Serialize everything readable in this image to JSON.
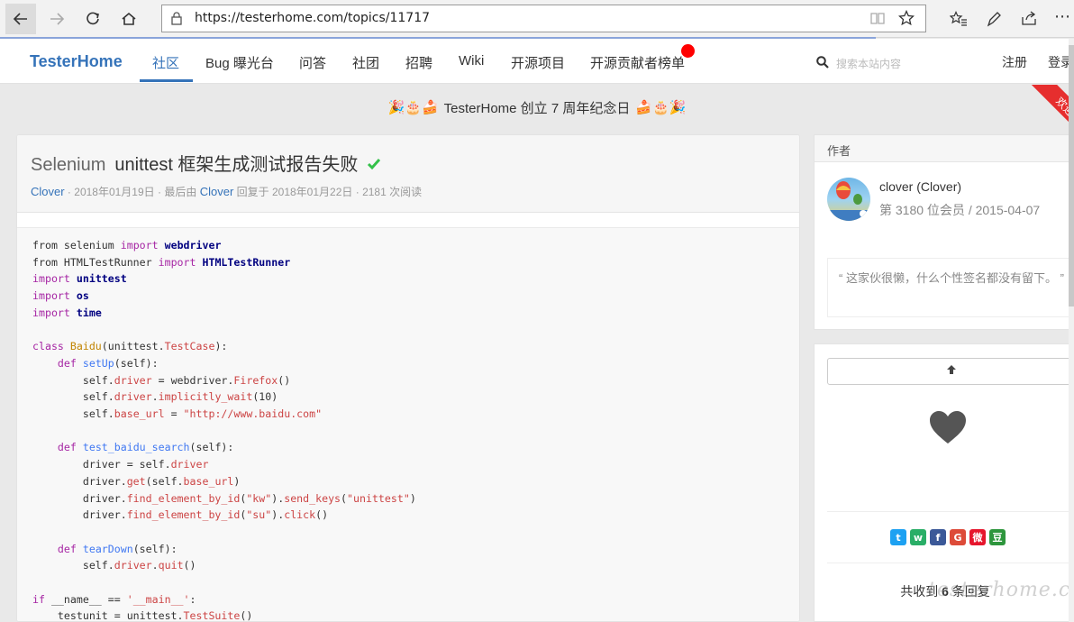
{
  "browser": {
    "url": "https://testerhome.com/topics/11717",
    "icons": [
      "back-arrow-icon",
      "forward-arrow-icon",
      "refresh-icon",
      "home-icon",
      "lock-icon",
      "reading-view-icon",
      "favorite-star-icon",
      "favorites-list-icon",
      "pen-icon",
      "share-icon",
      "more-icon"
    ]
  },
  "navbar": {
    "brand": "TesterHome",
    "items": [
      "社区",
      "Bug 曝光台",
      "问答",
      "社团",
      "招聘",
      "Wiki",
      "开源项目",
      "开源贡献者榜单"
    ],
    "search_placeholder": "搜索本站内容",
    "register": "注册",
    "login": "登录"
  },
  "announcement": {
    "text": "TesterHome 创立 7 周年纪念日",
    "emoji_left": "🎉🎂🍰",
    "emoji_right": "🍰🎂🎉",
    "ribbon": "欢迎"
  },
  "topic": {
    "node": "Selenium",
    "title": "unittest 框架生成测试报告失败",
    "author": "Clover",
    "created": "2018年01月19日",
    "last_reply_prefix": "最后由",
    "last_reply_user": "Clover",
    "last_reply_text": "回复于 2018年01月22日",
    "views": "2181 次阅读"
  },
  "author_card": {
    "header": "作者",
    "name": "clover (Clover)",
    "member_info": "第 3180 位会员 / 2015-04-07",
    "signature": "“ 这家伙很懒，什么个性签名都没有留下。 ”"
  },
  "actions": {
    "share_icons": [
      "twitter-icon",
      "wechat-icon",
      "facebook-icon",
      "google-plus-icon",
      "weibo-icon",
      "douban-icon"
    ],
    "reply_prefix": "共收到",
    "reply_count": "6",
    "reply_suffix": "条回复",
    "watermark": "testerhome.com"
  },
  "colors": {
    "brand": "#3573b9",
    "ribbon": "#e62e2e",
    "badge": "#ff0000"
  }
}
